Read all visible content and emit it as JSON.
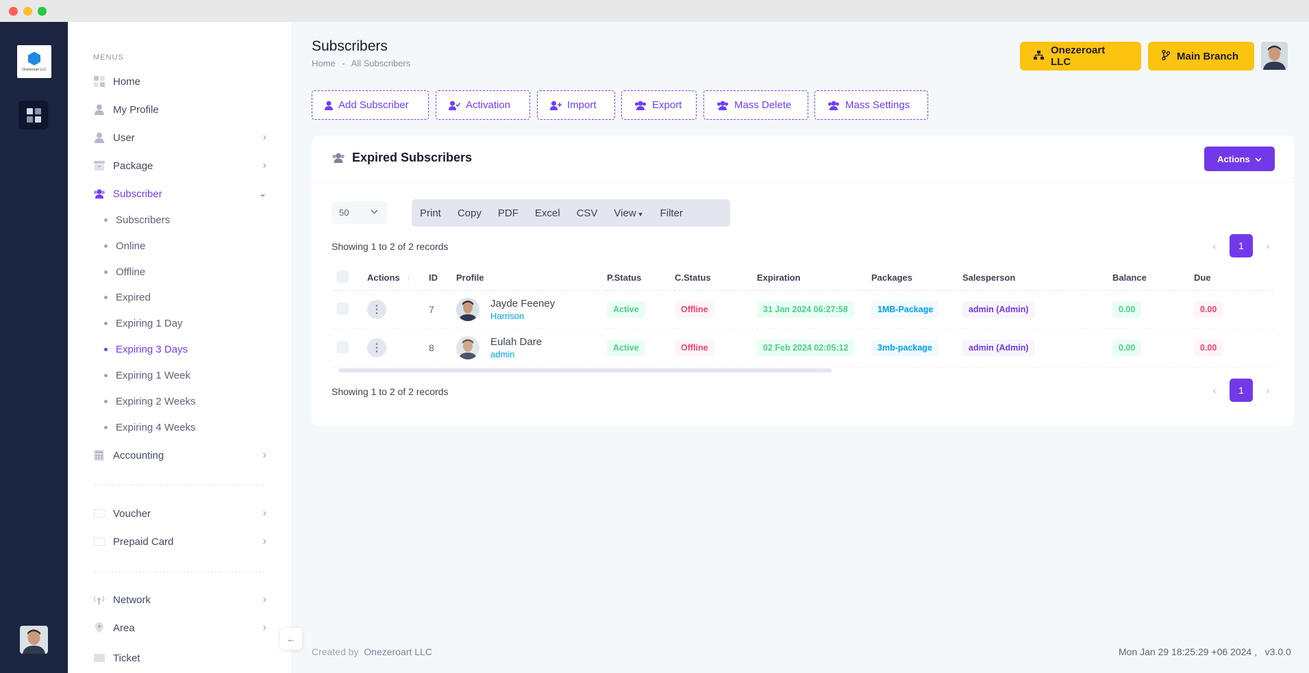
{
  "brand": {
    "logo_text": "Onezeroart LLC"
  },
  "sidebar": {
    "heading": "MENUS",
    "items": [
      {
        "label": "Home"
      },
      {
        "label": "My Profile"
      },
      {
        "label": "User"
      },
      {
        "label": "Package"
      },
      {
        "label": "Subscriber"
      },
      {
        "label": "Accounting"
      },
      {
        "label": "Voucher"
      },
      {
        "label": "Prepaid Card"
      },
      {
        "label": "Network"
      },
      {
        "label": "Area"
      },
      {
        "label": "Ticket"
      }
    ],
    "subitems": [
      {
        "label": "Subscribers"
      },
      {
        "label": "Online"
      },
      {
        "label": "Offline"
      },
      {
        "label": "Expired"
      },
      {
        "label": "Expiring 1 Day"
      },
      {
        "label": "Expiring 3 Days"
      },
      {
        "label": "Expiring 1 Week"
      },
      {
        "label": "Expiring 2 Weeks"
      },
      {
        "label": "Expiring 4 Weeks"
      }
    ]
  },
  "header": {
    "title": "Subscribers",
    "breadcrumb_home": "Home",
    "breadcrumb_sep": "-",
    "breadcrumb_current": "All Subscribers",
    "company_button": "Onezeroart LLC",
    "branch_button": "Main Branch"
  },
  "toolbar": {
    "add": "Add Subscriber",
    "activation": "Activation",
    "import": "Import",
    "export": "Export",
    "mass_delete": "Mass Delete",
    "mass_settings": "Mass Settings"
  },
  "card": {
    "title": "Expired Subscribers",
    "actions_label": "Actions",
    "page_length": "50",
    "dt_buttons": [
      "Print",
      "Copy",
      "PDF",
      "Excel",
      "CSV",
      "View",
      "Filter"
    ],
    "info": "Showing 1 to 2 of 2 records",
    "page": "1"
  },
  "table": {
    "columns": [
      "Actions",
      "ID",
      "Profile",
      "P.Status",
      "C.Status",
      "Expiration",
      "Packages",
      "Salesperson",
      "Balance",
      "Due"
    ],
    "rows": [
      {
        "id": "7",
        "name": "Jayde Feeney",
        "sub": "Harrison",
        "pstatus": "Active",
        "cstatus": "Offline",
        "expiration": "31 Jan 2024 06:27:58",
        "package": "1MB-Package",
        "salesperson": "admin (Admin)",
        "balance": "0.00",
        "due": "0.00"
      },
      {
        "id": "8",
        "name": "Eulah Dare",
        "sub": "admin",
        "pstatus": "Active",
        "cstatus": "Offline",
        "expiration": "02 Feb 2024 02:05:12",
        "package": "3mb-package",
        "salesperson": "admin (Admin)",
        "balance": "0.00",
        "due": "0.00"
      }
    ]
  },
  "footer": {
    "created_by": "Created by",
    "company": "Onezeroart LLC",
    "datetime": "Mon Jan 29 18:25:29 +06 2024 ,",
    "version": "v3.0.0"
  },
  "colors": {
    "accent": "#7239ea",
    "yellow": "#fcc30f",
    "rail": "#1c2541"
  }
}
